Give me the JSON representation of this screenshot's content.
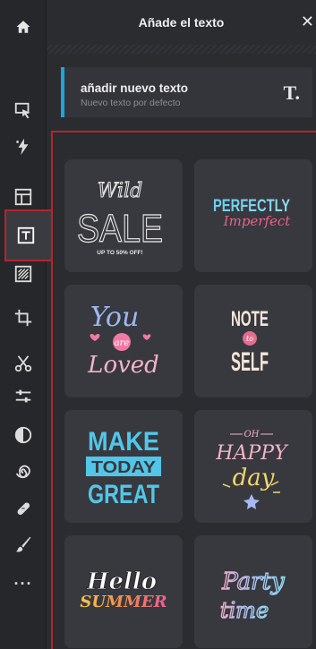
{
  "header": {
    "title": "Añade el texto",
    "close_icon": "close-icon"
  },
  "sidebar": {
    "home_icon": "home-icon",
    "tools": [
      "select-icon",
      "magic-icon",
      "layout-icon",
      "text-icon",
      "texture-icon",
      "crop-icon",
      "cut-icon",
      "adjust-icon",
      "contrast-icon",
      "spiral-icon",
      "bandage-icon",
      "brush-icon"
    ],
    "more": "···"
  },
  "add_text": {
    "title": "añadir nuevo texto",
    "subtitle": "Nuevo texto por defecto",
    "icon": "T."
  },
  "presets": [
    {
      "lines": [
        "Wild",
        "SALE",
        "UP TO 50% OFF!"
      ]
    },
    {
      "lines": [
        "PERFECTLY",
        "Imperfect"
      ]
    },
    {
      "lines": [
        "You",
        "are",
        "Loved"
      ]
    },
    {
      "lines": [
        "NOTE",
        "to",
        "SELF"
      ]
    },
    {
      "lines": [
        "MAKE",
        "TODAY",
        "GREAT"
      ]
    },
    {
      "lines": [
        "OH",
        "HAPPY",
        "day"
      ]
    },
    {
      "lines": [
        "Hello",
        "SUMMER"
      ]
    },
    {
      "lines": [
        "Party",
        "time"
      ]
    }
  ],
  "colors": {
    "accent": "#1fa3d8",
    "highlight": "#b3262c"
  }
}
